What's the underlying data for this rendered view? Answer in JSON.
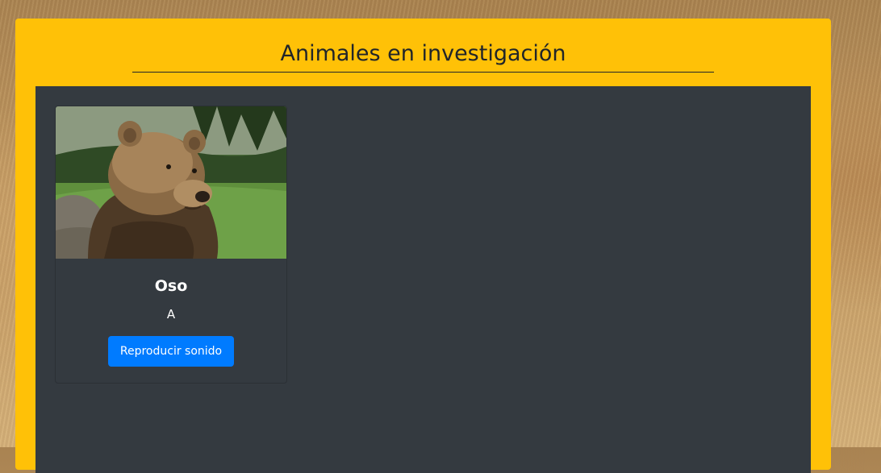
{
  "header": {
    "title": "Animales en investigación"
  },
  "animals": [
    {
      "name": "Oso",
      "letter": "A",
      "button_label": "Reproducir sonido",
      "image": "brown-bear-photo"
    }
  ],
  "colors": {
    "panel": "#ffc107",
    "content": "#343a40",
    "button": "#007bff"
  }
}
